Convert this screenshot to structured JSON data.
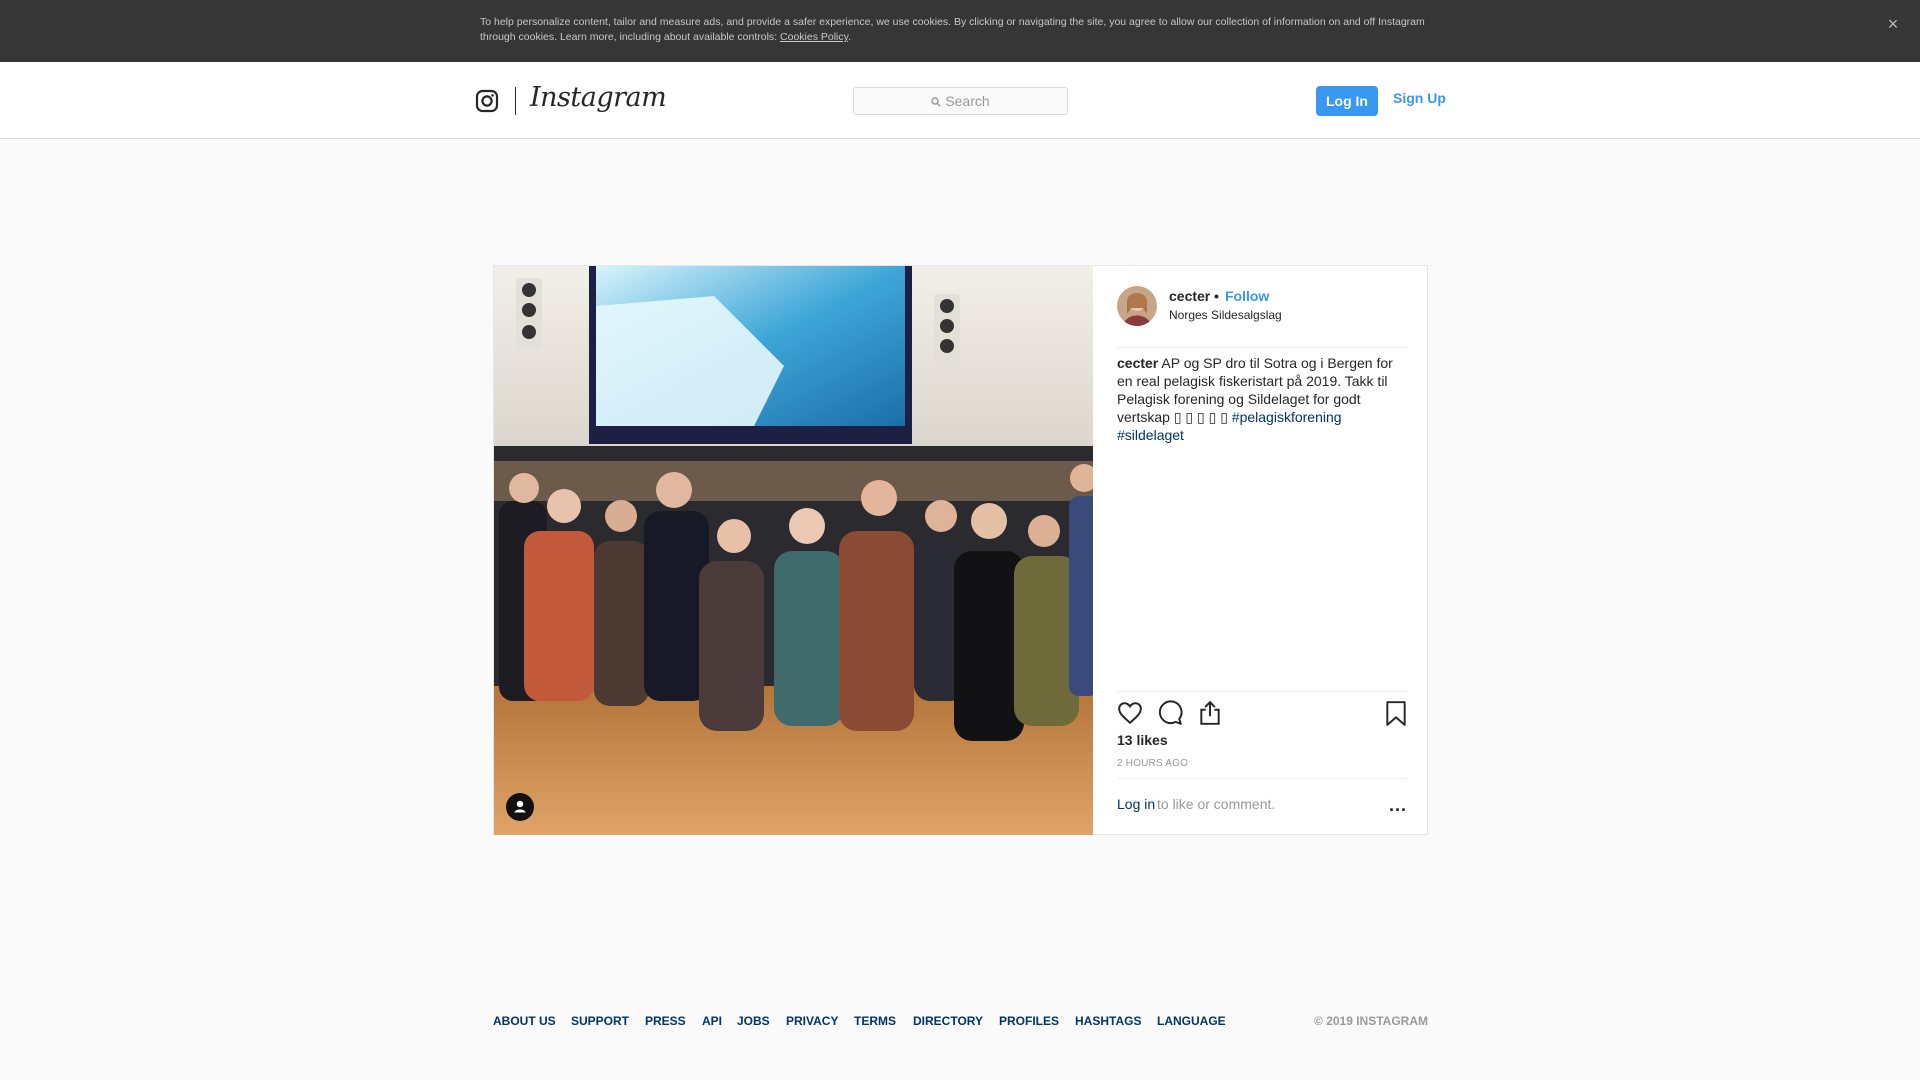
{
  "cookie_banner": {
    "text": "To help personalize content, tailor and measure ads, and provide a safer experience, we use cookies. By clicking or navigating the site, you agree to allow our collection of information on and off Instagram through cookies. Learn more, including about available controls: ",
    "link": "Cookies Policy",
    "period": ".",
    "close": "×"
  },
  "header": {
    "wordmark": "Instagram",
    "search_placeholder": "Search",
    "login": "Log In",
    "signup": "Sign Up"
  },
  "post": {
    "username": "cecter",
    "separator": "•",
    "follow": "Follow",
    "location": "Norges Sildesalgslag",
    "caption_user": "cecter",
    "caption_text": " AP og SP dro til Sotra og i Bergen for en real pelagisk fiskeristart på 2019. Takk til Pelagisk forening og Sildelaget for godt vertskap  ",
    "emoji_boxes": "▯ ▯ ▯ ▯ ▯",
    "hashtags": [
      "#pelagiskforening",
      "#sildelaget"
    ],
    "likes": "13 likes",
    "time": "2 HOURS AGO",
    "login_link": "Log in",
    "comment_prompt": " to like or comment.",
    "more": "..."
  },
  "footer": {
    "links": [
      "ABOUT US",
      "SUPPORT",
      "PRESS",
      "API",
      "JOBS",
      "PRIVACY",
      "TERMS",
      "DIRECTORY",
      "PROFILES",
      "HASHTAGS",
      "LANGUAGE"
    ],
    "copyright": "© 2019 INSTAGRAM"
  },
  "colors": {
    "accent": "#3897f0",
    "link_dark": "#003569",
    "banner_bg": "#363636"
  }
}
